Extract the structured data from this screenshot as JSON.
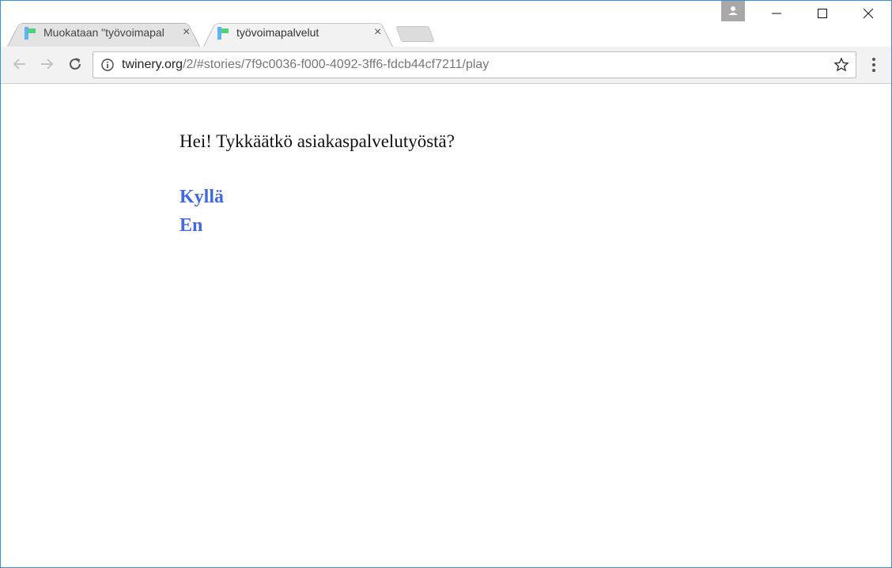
{
  "tabs": [
    {
      "title": "Muokataan \"työvoimapal",
      "state": "inactive"
    },
    {
      "title": "työvoimapalvelut",
      "state": "active"
    }
  ],
  "tab_close_glyph": "×",
  "window_controls": {
    "minimize": "—",
    "maximize": "☐",
    "close": "✕"
  },
  "toolbar": {
    "back_icon": "back-arrow-icon",
    "forward_icon": "forward-arrow-icon",
    "reload_icon": "reload-icon"
  },
  "address_bar": {
    "host": "twinery.org",
    "path": "/2/#stories/7f9c0036-f000-4092-3ff6-fdcb44cf7211/play"
  },
  "story": {
    "passage_text": "Hei! Tykkäätkö asiakaspalvelutyöstä?",
    "links": [
      "Kyllä",
      "En"
    ]
  },
  "colors": {
    "link": "#4169e1",
    "window_border": "#3a8fd9",
    "toolbar_bg": "#f2f2f2"
  }
}
